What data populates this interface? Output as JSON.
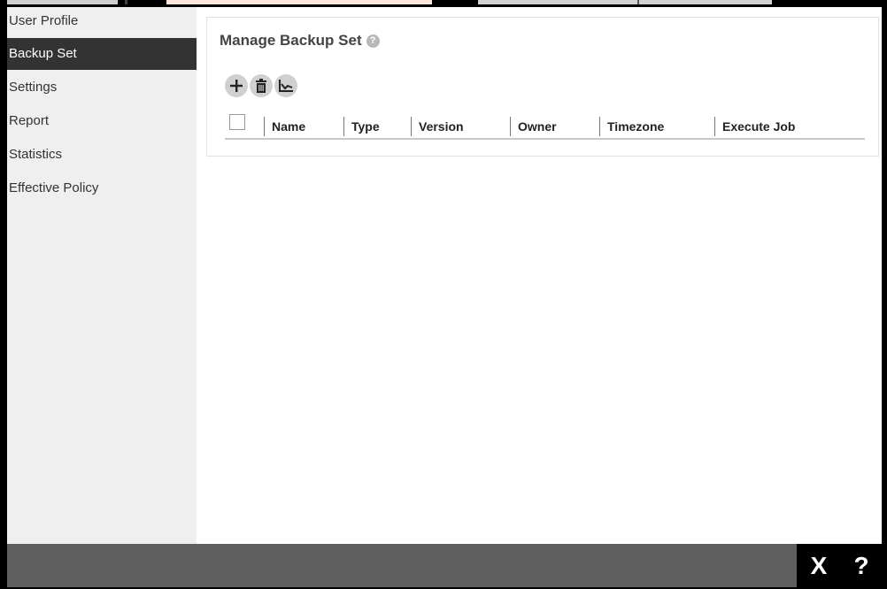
{
  "sidebar": {
    "items": [
      {
        "label": "User Profile",
        "active": false
      },
      {
        "label": "Backup Set",
        "active": true
      },
      {
        "label": "Settings",
        "active": false
      },
      {
        "label": "Report",
        "active": false
      },
      {
        "label": "Statistics",
        "active": false
      },
      {
        "label": "Effective Policy",
        "active": false
      }
    ]
  },
  "main": {
    "title": "Manage Backup Set",
    "help_glyph": "?",
    "toolbar": {
      "add_icon": "plus-icon",
      "delete_icon": "trash-icon",
      "stats_icon": "chart-icon"
    },
    "table": {
      "columns": [
        "Name",
        "Type",
        "Version",
        "Owner",
        "Timezone",
        "Execute Job"
      ]
    }
  },
  "footer": {
    "close_label": "X",
    "help_label": "?"
  },
  "colors": {
    "sidebar_bg": "#efefef",
    "active_item_bg": "#333333",
    "footer_bg": "#5e5e5e",
    "tab_accent": "#fde7dc"
  }
}
